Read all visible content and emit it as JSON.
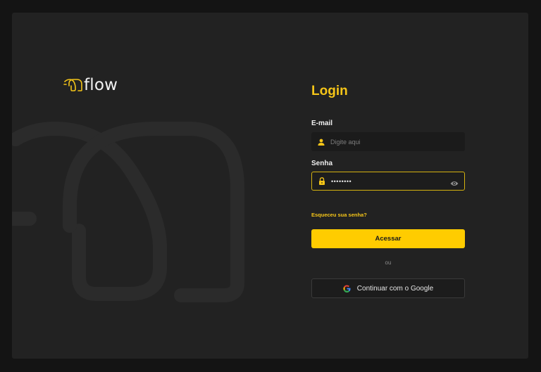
{
  "brand": {
    "name": "flow",
    "accent": "#f5c518"
  },
  "login": {
    "title": "Login",
    "email": {
      "label": "E-mail",
      "placeholder": "Digite aqui",
      "value": "",
      "icon": "user-icon"
    },
    "password": {
      "label": "Senha",
      "value": "••••••••",
      "icon": "lock-icon",
      "toggle_icon": "eye-icon"
    },
    "forgot_label": "Esqueceu sua senha?",
    "submit_label": "Acessar",
    "divider_label": "ou",
    "google_label": "Continuar com o Google"
  }
}
